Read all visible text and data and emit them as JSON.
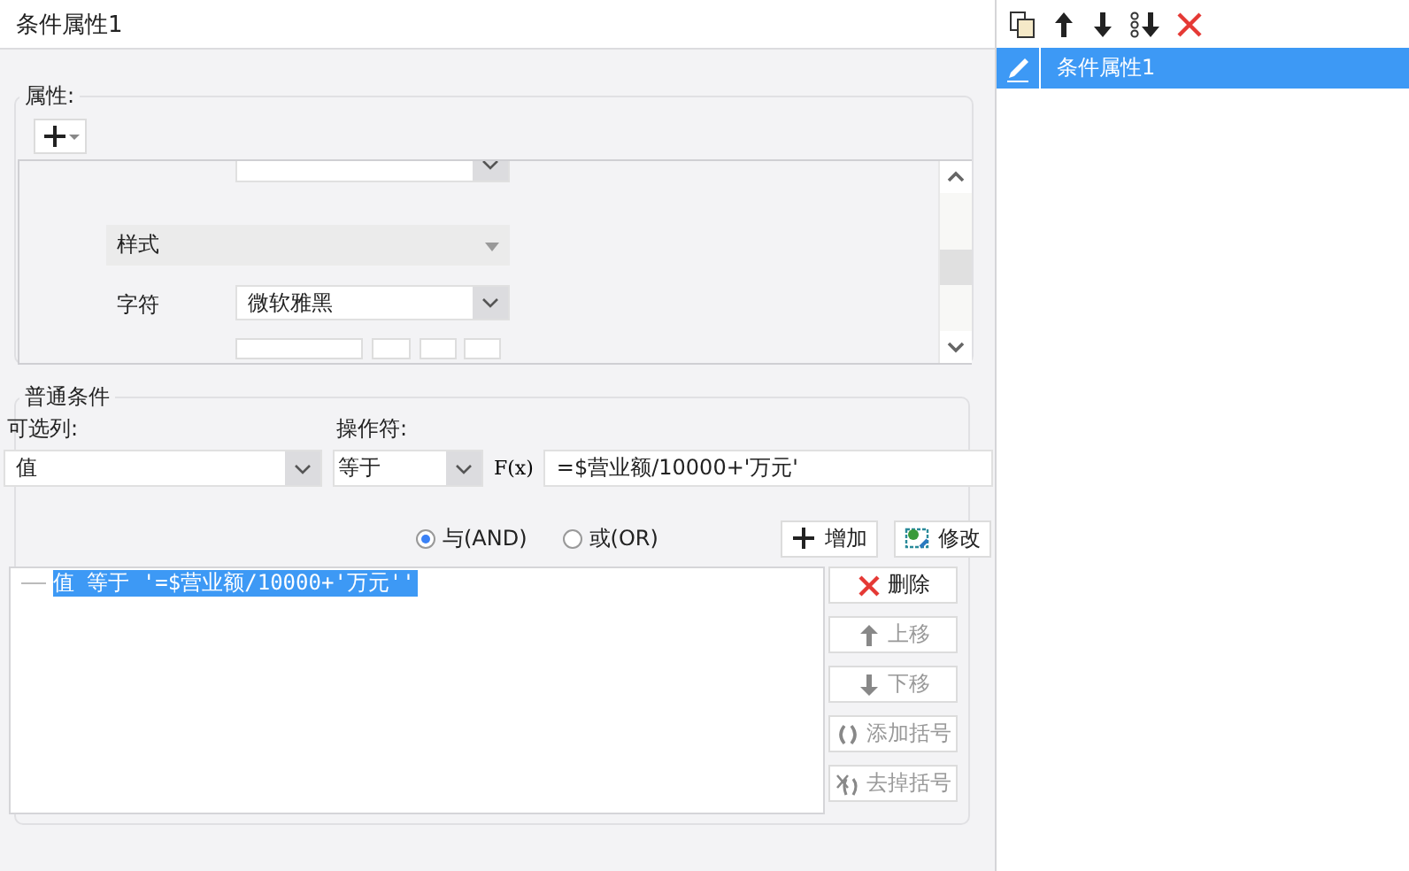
{
  "window": {
    "title": "条件属性1"
  },
  "properties": {
    "label": "属性:",
    "style_label": "样式",
    "font_label": "字符",
    "font_value": "微软雅黑"
  },
  "conditions": {
    "label": "普通条件",
    "column_label": "可选列:",
    "operator_label": "操作符:",
    "column_value": "值",
    "operator_value": "等于",
    "fx_button": "F(x)",
    "formula_value": "=$营业额/10000+'万元'",
    "logic": [
      {
        "label": "与(AND)",
        "selected": true
      },
      {
        "label": "或(OR)",
        "selected": false
      }
    ],
    "actions": [
      {
        "label": "增加",
        "kind": "add"
      },
      {
        "label": "修改",
        "kind": "edit"
      }
    ],
    "items": [
      {
        "text": "值 等于 '=$营业额/10000+'万元''",
        "selected": true
      }
    ],
    "side_buttons": [
      {
        "label": "删除",
        "kind": "delete",
        "disabled": false
      },
      {
        "label": "上移",
        "kind": "up",
        "disabled": true
      },
      {
        "label": "下移",
        "kind": "down",
        "disabled": true
      },
      {
        "label": "添加括号",
        "kind": "add-paren",
        "disabled": true
      },
      {
        "label": "去掉括号",
        "kind": "remove-paren",
        "disabled": true
      }
    ]
  },
  "sidebar": {
    "items": [
      {
        "label": "条件属性1",
        "selected": true
      }
    ]
  }
}
